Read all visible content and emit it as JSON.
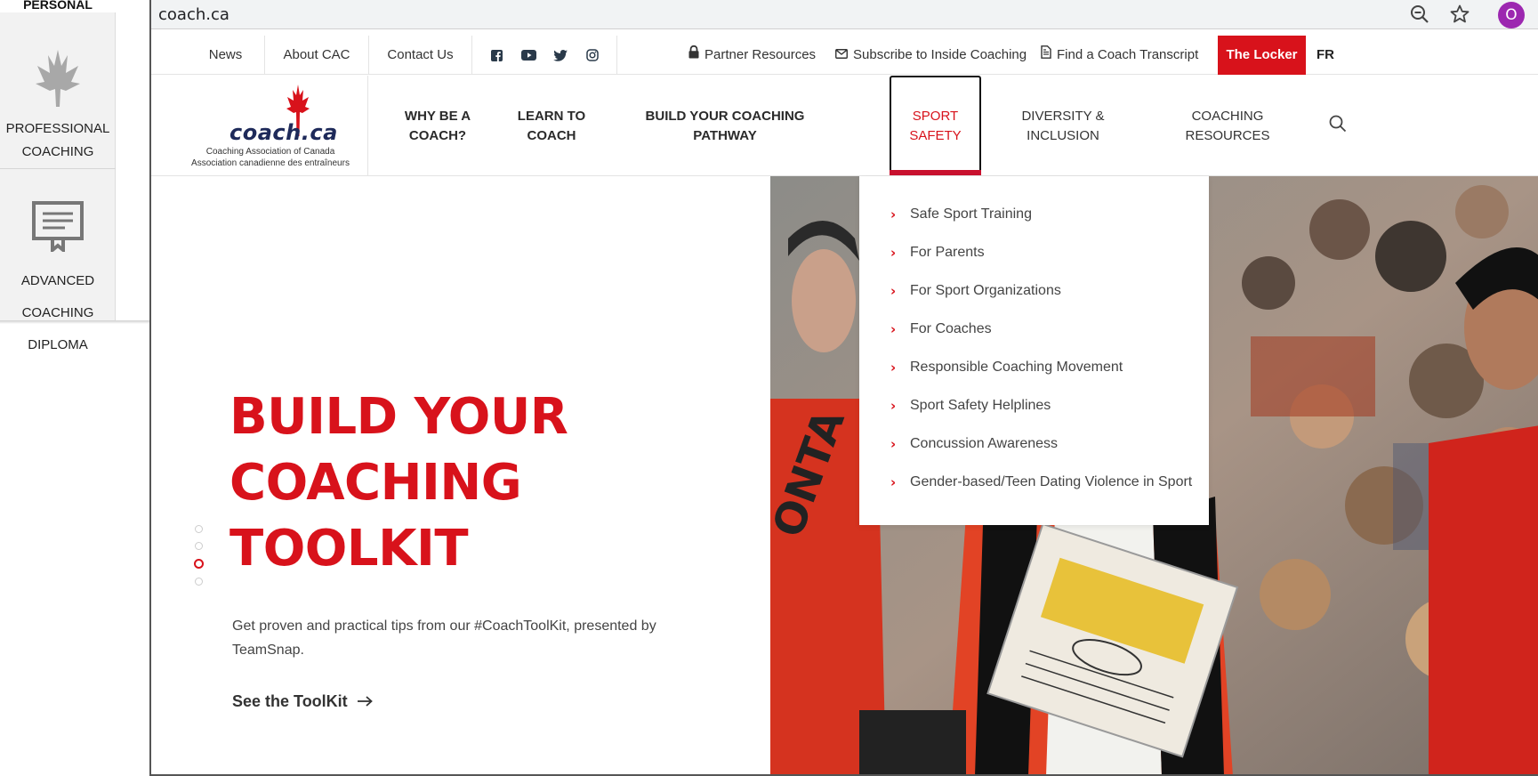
{
  "background_panel": {
    "top_label": "PERSONAL",
    "cards": [
      {
        "label_lines": [
          "PROFESSIONAL",
          "COACHING"
        ]
      },
      {
        "label_lines": [
          "ADVANCED",
          "COACHING",
          "DIPLOMA"
        ]
      }
    ]
  },
  "browser": {
    "url": "coach.ca",
    "profile_initial": "O",
    "profile_color": "#9c27b0"
  },
  "utility_nav": {
    "links": [
      "News",
      "About CAC",
      "Contact Us"
    ],
    "social_icons": [
      "facebook-icon",
      "youtube-icon",
      "twitter-icon",
      "instagram-icon"
    ],
    "partner_resources": "Partner Resources",
    "subscribe": "Subscribe to Inside Coaching",
    "transcript": "Find a Coach Transcript",
    "locker": "The Locker",
    "language": "FR"
  },
  "logo": {
    "wordmark": "coach.ca",
    "line1": "Coaching Association of Canada",
    "line2": "Association canadienne des entraîneurs"
  },
  "main_nav": {
    "items": [
      {
        "line1": "WHY BE A",
        "line2": "COACH?"
      },
      {
        "line1": "LEARN TO",
        "line2": "COACH"
      },
      {
        "line1": "BUILD YOUR COACHING",
        "line2": "PATHWAY"
      },
      {
        "line1": "SPORT",
        "line2": "SAFETY"
      },
      {
        "line1": "DIVERSITY &",
        "line2": "INCLUSION"
      },
      {
        "line1": "COACHING",
        "line2": "RESOURCES"
      }
    ]
  },
  "dropdown": {
    "items": [
      "Safe Sport Training",
      "For Parents",
      "For Sport Organizations",
      "For Coaches",
      "Responsible Coaching Movement",
      "Sport Safety Helplines",
      "Concussion Awareness",
      "Gender-based/Teen Dating Violence in Sport"
    ]
  },
  "hero": {
    "title_lines": [
      "BUILD YOUR",
      "COACHING",
      "TOOLKIT"
    ],
    "description": "Get proven and practical tips from our #CoachToolKit, presented by TeamSnap.",
    "cta": "See the ToolKit",
    "slides": 4,
    "active_slide": 3
  },
  "colors": {
    "accent": "#d8121b",
    "text": "#333333",
    "navy": "#1e2a5a"
  }
}
